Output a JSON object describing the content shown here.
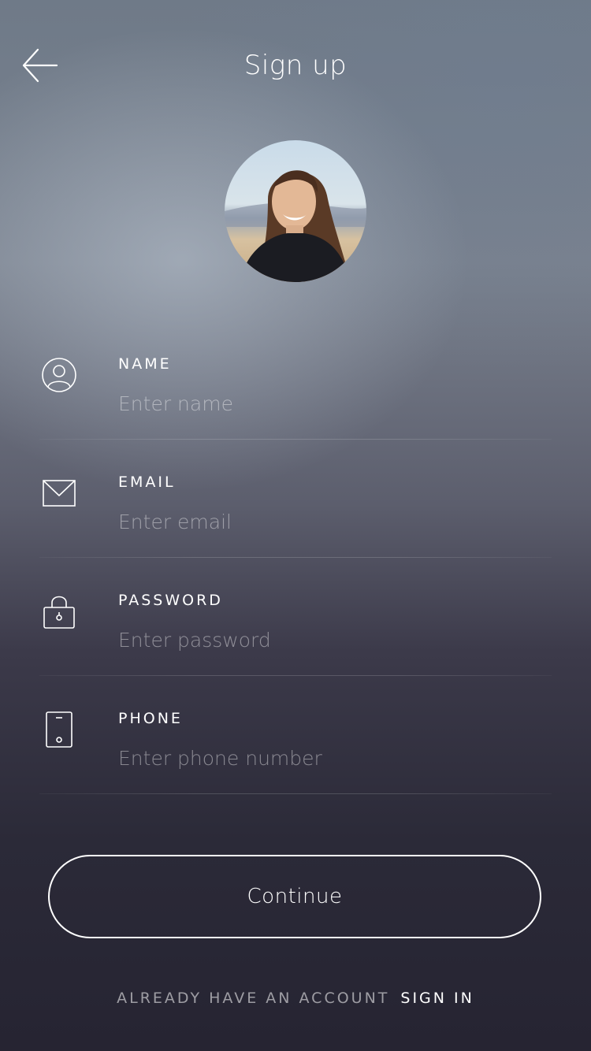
{
  "header": {
    "title": "Sign up",
    "back_icon": "arrow-left-icon"
  },
  "avatar": {
    "description_icon": "profile-photo"
  },
  "fields": [
    {
      "label": "NAME",
      "placeholder": "Enter name",
      "value": "",
      "icon": "user-icon"
    },
    {
      "label": "EMAIL",
      "placeholder": "Enter email",
      "value": "",
      "icon": "envelope-icon"
    },
    {
      "label": "PASSWORD",
      "placeholder": "Enter password",
      "value": "",
      "icon": "lock-icon"
    },
    {
      "label": "PHONE",
      "placeholder": "Enter phone number",
      "value": "",
      "icon": "phone-icon"
    }
  ],
  "actions": {
    "continue_label": "Continue"
  },
  "footer": {
    "prompt": "ALREADY HAVE AN ACCOUNT",
    "signin_label": "SIGN IN"
  },
  "colors": {
    "text": "#ffffff",
    "background_top": "#6f7a88",
    "background_bottom": "#262432"
  }
}
